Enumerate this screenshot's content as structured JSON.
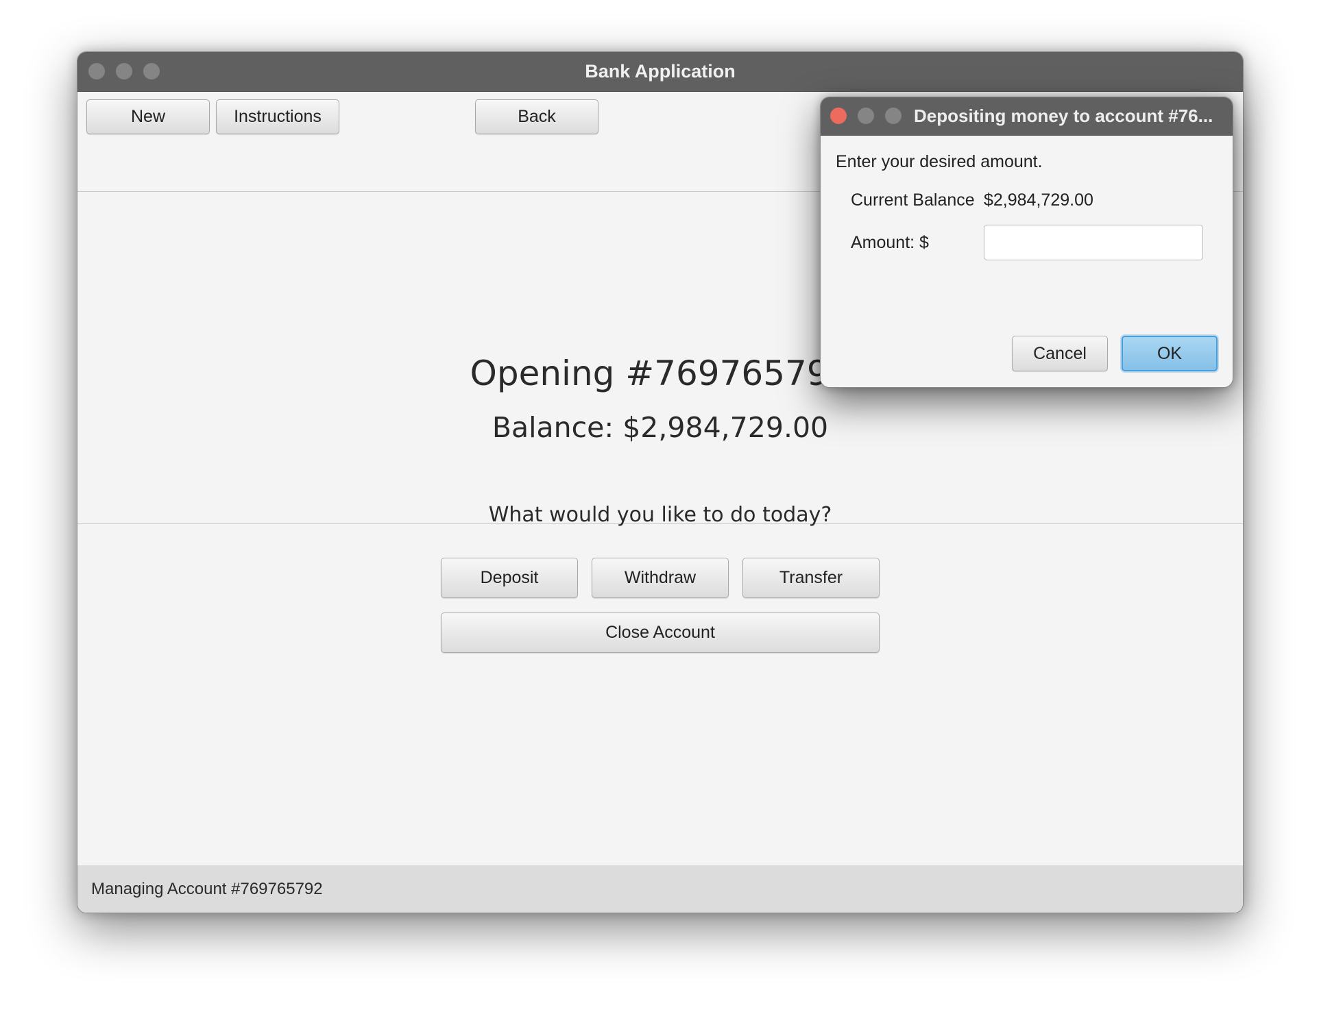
{
  "window": {
    "title": "Bank Application"
  },
  "toolbar": {
    "new_label": "New",
    "instructions_label": "Instructions",
    "back_label": "Back"
  },
  "main": {
    "opening_heading": "Opening #769765792",
    "balance_heading": "Balance: $2,984,729.00",
    "prompt": "What would you like to do today?",
    "deposit_label": "Deposit",
    "withdraw_label": "Withdraw",
    "transfer_label": "Transfer",
    "close_account_label": "Close Account"
  },
  "status_bar": {
    "text": "Managing Account #769765792"
  },
  "dialog": {
    "title": "Depositing money to account #76...",
    "instruction": "Enter your desired amount.",
    "current_balance_label": "Current Balance",
    "current_balance_value": "$2,984,729.00",
    "amount_label": "Amount: $",
    "amount_value": "",
    "cancel_label": "Cancel",
    "ok_label": "OK"
  },
  "colors": {
    "titlebar": "#606060",
    "close_red": "#ed6a5e",
    "inactive_light": "#858585",
    "accent_blue": "#4a9fd8"
  }
}
